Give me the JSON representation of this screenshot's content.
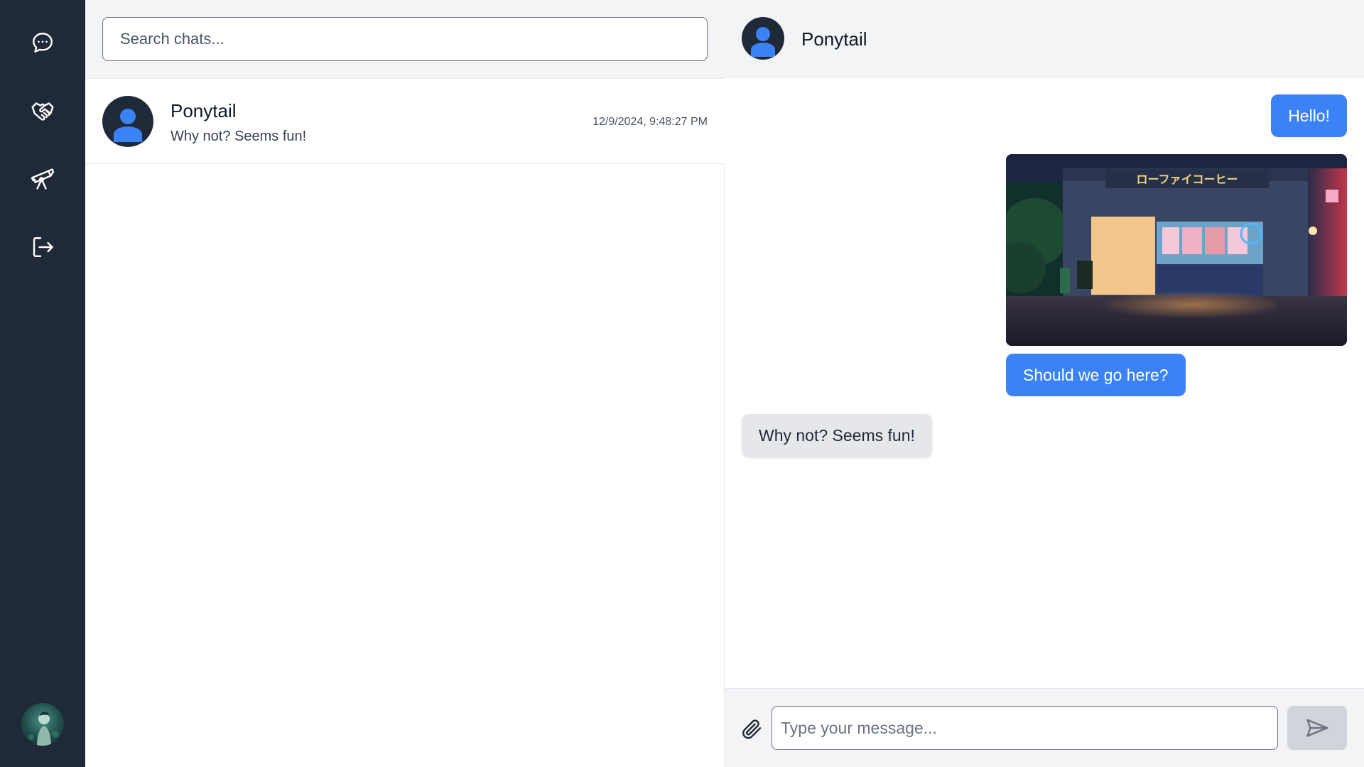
{
  "sidebar": {
    "items": [
      {
        "icon": "chat-bubble-icon",
        "label": ""
      },
      {
        "icon": "handshake-icon",
        "label": ""
      },
      {
        "icon": "telescope-icon",
        "label": ""
      },
      {
        "icon": "logout-icon",
        "label": ""
      }
    ],
    "user_avatar_icon": "user-avatar"
  },
  "search": {
    "placeholder": "Search chats..."
  },
  "chat_list": [
    {
      "name": "Ponytail",
      "preview": "Why not? Seems fun!",
      "timestamp": "12/9/2024, 9:48:27 PM"
    }
  ],
  "conversation": {
    "contact_name": "Ponytail",
    "messages": [
      {
        "direction": "sent",
        "type": "text",
        "text": "Hello!"
      },
      {
        "direction": "sent",
        "type": "image",
        "image_caption": "ローファイコーヒー"
      },
      {
        "direction": "sent",
        "type": "text",
        "text": "Should we go here?"
      },
      {
        "direction": "received",
        "type": "text",
        "text": "Why not? Seems fun!"
      }
    ]
  },
  "composer": {
    "placeholder": "Type your message...",
    "attach_icon": "paperclip-icon",
    "send_icon": "send-icon"
  },
  "colors": {
    "sidebar_bg": "#1f2937",
    "accent": "#3b82f6",
    "received_bubble": "#e5e7eb",
    "header_bg": "#f3f4f6"
  }
}
